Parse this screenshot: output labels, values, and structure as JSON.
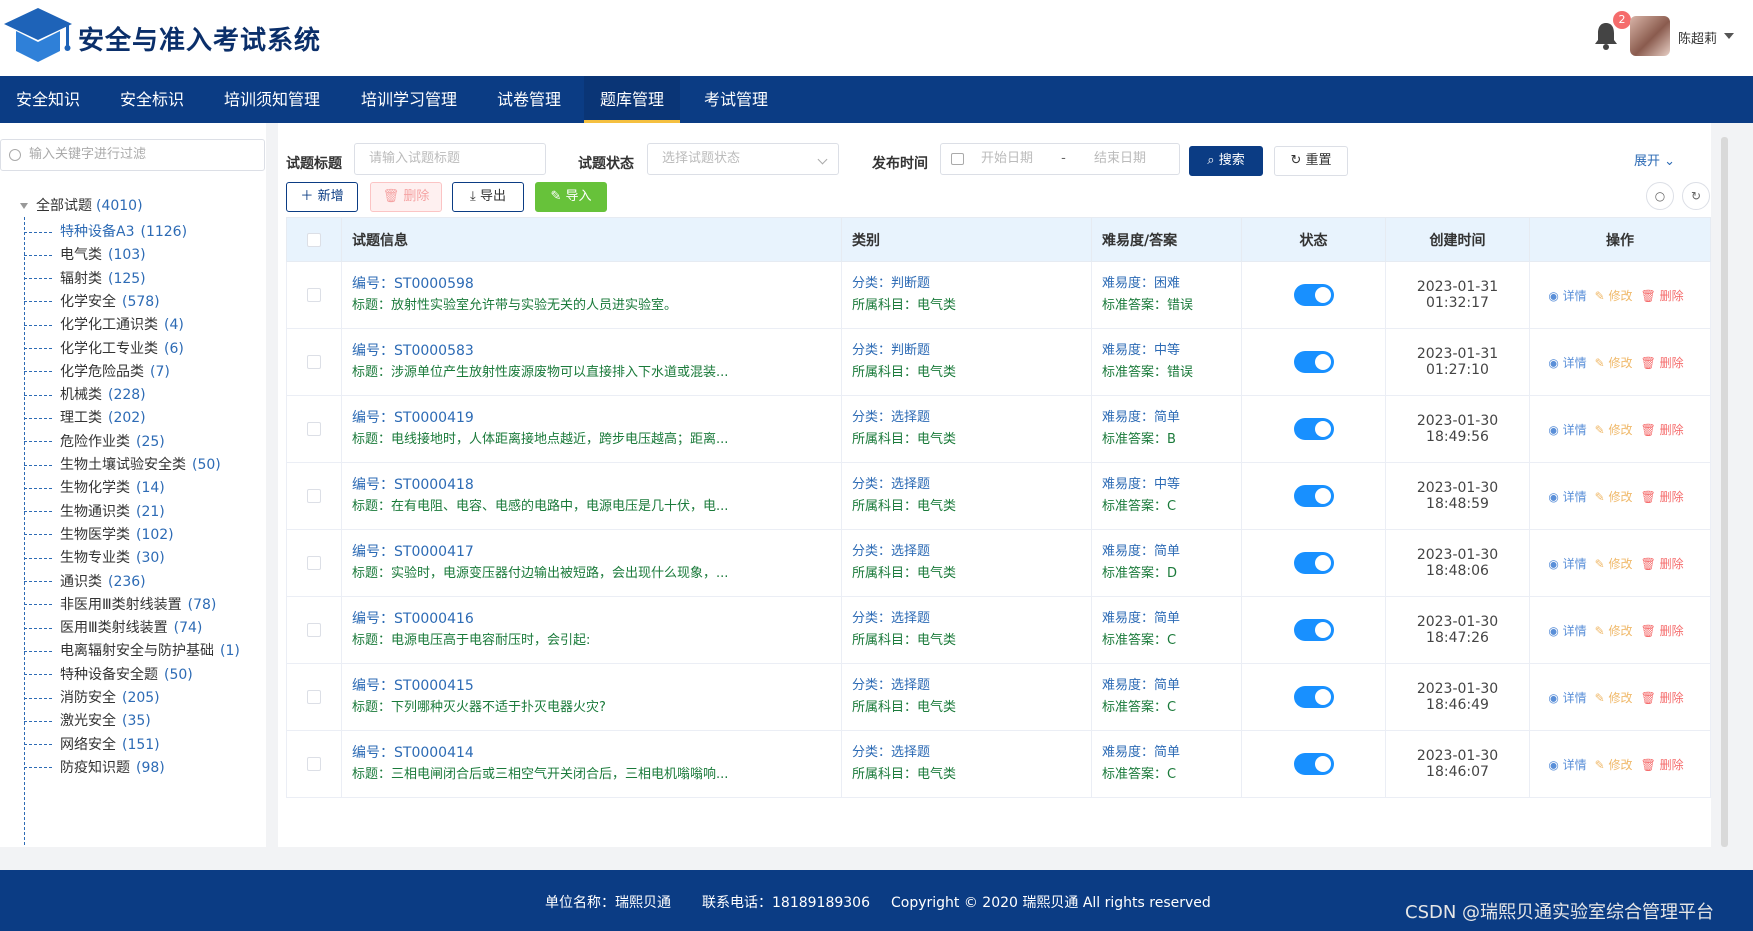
{
  "app": {
    "title": "安全与准入考试系统"
  },
  "user": {
    "name": "陈超莉",
    "notifications": "2"
  },
  "nav": [
    {
      "label": "安全知识"
    },
    {
      "label": "安全标识"
    },
    {
      "label": "培训须知管理"
    },
    {
      "label": "培训学习管理"
    },
    {
      "label": "试卷管理"
    },
    {
      "label": "题库管理"
    },
    {
      "label": "考试管理"
    }
  ],
  "sidebar": {
    "search_placeholder": "输入关键字进行过滤",
    "root": {
      "label": "全部试题",
      "count": "(4010)"
    },
    "items": [
      {
        "label": "特种设备A3",
        "count": "(1126)"
      },
      {
        "label": "电气类",
        "count": "(103)"
      },
      {
        "label": "辐射类",
        "count": "(125)"
      },
      {
        "label": "化学安全",
        "count": "(578)"
      },
      {
        "label": "化学化工通识类",
        "count": "(4)"
      },
      {
        "label": "化学化工专业类",
        "count": "(6)"
      },
      {
        "label": "化学危险品类",
        "count": "(7)"
      },
      {
        "label": "机械类",
        "count": "(228)"
      },
      {
        "label": "理工类",
        "count": "(202)"
      },
      {
        "label": "危险作业类",
        "count": "(25)"
      },
      {
        "label": "生物土壤试验安全类",
        "count": "(50)"
      },
      {
        "label": "生物化学类",
        "count": "(14)"
      },
      {
        "label": "生物通识类",
        "count": "(21)"
      },
      {
        "label": "生物医学类",
        "count": "(102)"
      },
      {
        "label": "生物专业类",
        "count": "(30)"
      },
      {
        "label": "通识类",
        "count": "(236)"
      },
      {
        "label": "非医用Ⅲ类射线装置",
        "count": "(78)"
      },
      {
        "label": "医用Ⅲ类射线装置",
        "count": "(74)"
      },
      {
        "label": "电离辐射安全与防护基础",
        "count": "(1)"
      },
      {
        "label": "特种设备安全题",
        "count": "(50)"
      },
      {
        "label": "消防安全",
        "count": "(205)"
      },
      {
        "label": "激光安全",
        "count": "(35)"
      },
      {
        "label": "网络安全",
        "count": "(151)"
      },
      {
        "label": "防疫知识题",
        "count": "(98)"
      }
    ]
  },
  "filters": {
    "title_label": "试题标题",
    "title_placeholder": "请输入试题标题",
    "status_label": "试题状态",
    "status_placeholder": "选择试题状态",
    "time_label": "发布时间",
    "start_placeholder": "开始日期",
    "sep": "-",
    "end_placeholder": "结束日期",
    "search": "搜索",
    "reset": "重置",
    "expand": "展开"
  },
  "toolbar": {
    "add": "新增",
    "delete": "删除",
    "export": "导出",
    "import": "导入"
  },
  "table": {
    "headers": [
      "试题信息",
      "类别",
      "难易度/答案",
      "状态",
      "创建时间",
      "操作"
    ],
    "row_labels": {
      "id": "编号：",
      "title": "标题：",
      "type": "分类：",
      "subject": "所属科目：",
      "difficulty": "难易度：",
      "answer": "标准答案："
    },
    "actions": {
      "view": "详情",
      "edit": "修改",
      "delete": "删除"
    },
    "rows": [
      {
        "id": "ST0000598",
        "title": "放射性实验室允许带与实验无关的人员进实验室。",
        "type": "判断题",
        "subject": "电气类",
        "difficulty": "困难",
        "answer": "错误",
        "time": "2023-01-31 01:32:17",
        "enabled": true
      },
      {
        "id": "ST0000583",
        "title": "涉源单位产生放射性废源废物可以直接排入下水道或混装...",
        "type": "判断题",
        "subject": "电气类",
        "difficulty": "中等",
        "answer": "错误",
        "time": "2023-01-31 01:27:10",
        "enabled": true
      },
      {
        "id": "ST0000419",
        "title": "电线接地时，人体距离接地点越近，跨步电压越高；距离...",
        "type": "选择题",
        "subject": "电气类",
        "difficulty": "简单",
        "answer": "B",
        "time": "2023-01-30 18:49:56",
        "enabled": true
      },
      {
        "id": "ST0000418",
        "title": "在有电阻、电容、电感的电路中，电源电压是几十伏，电...",
        "type": "选择题",
        "subject": "电气类",
        "difficulty": "中等",
        "answer": "C",
        "time": "2023-01-30 18:48:59",
        "enabled": true
      },
      {
        "id": "ST0000417",
        "title": "实验时，电源变压器付边输出被短路，会出现什么现象，...",
        "type": "选择题",
        "subject": "电气类",
        "difficulty": "简单",
        "answer": "D",
        "time": "2023-01-30 18:48:06",
        "enabled": true
      },
      {
        "id": "ST0000416",
        "title": "电源电压高于电容耐压时，会引起:",
        "type": "选择题",
        "subject": "电气类",
        "difficulty": "简单",
        "answer": "C",
        "time": "2023-01-30 18:47:26",
        "enabled": true
      },
      {
        "id": "ST0000415",
        "title": "下列哪种灭火器不适于扑灭电器火灾?",
        "type": "选择题",
        "subject": "电气类",
        "difficulty": "简单",
        "answer": "C",
        "time": "2023-01-30 18:46:49",
        "enabled": true
      },
      {
        "id": "ST0000414",
        "title": "三相电闸闭合后或三相空气开关闭合后，三相电机嗡嗡响...",
        "type": "选择题",
        "subject": "电气类",
        "difficulty": "简单",
        "answer": "C",
        "time": "2023-01-30 18:46:07",
        "enabled": true
      }
    ]
  },
  "footer": {
    "unit": "单位名称：瑞熙贝通",
    "phone": "联系电话：18189189306",
    "copyright": "Copyright © 2020 瑞熙贝通 All rights reserved",
    "watermark": "CSDN @瑞熙贝通实验室综合管理平台"
  },
  "colors": {
    "primary": "#0b3c84",
    "accent": "#f5c040",
    "link": "#2d6bb5",
    "success": "#67c23a",
    "danger": "#f56c6c"
  }
}
